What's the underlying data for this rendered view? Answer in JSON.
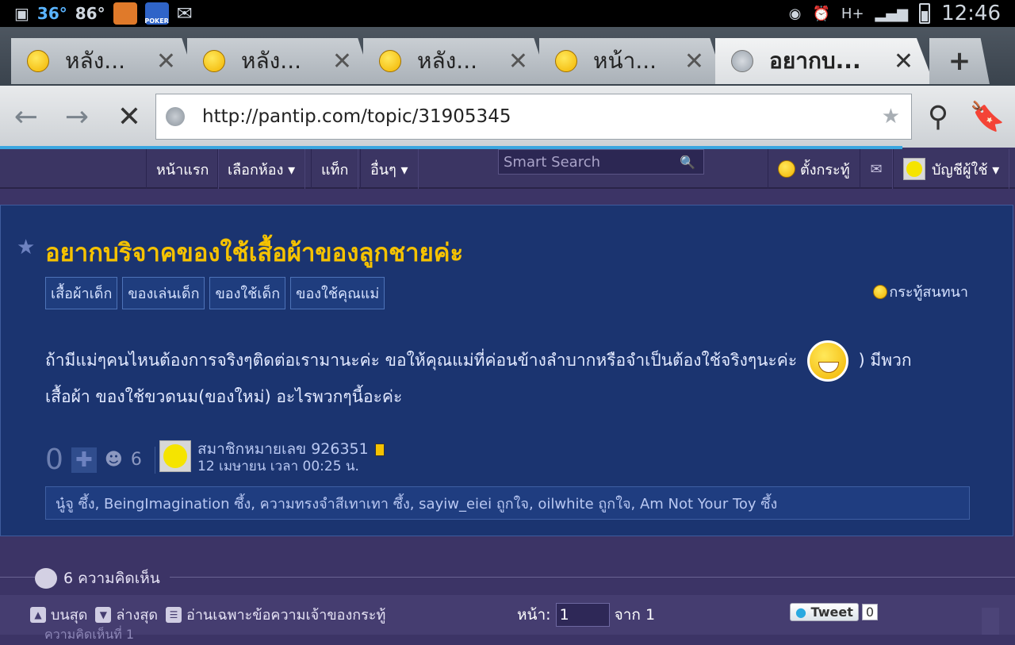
{
  "status_bar": {
    "temp_c": "36°",
    "temp_f": "86°",
    "time": "12:46",
    "network": "H+",
    "app_poker": "POKER"
  },
  "tabs": [
    {
      "label": "หลัง...",
      "active": false
    },
    {
      "label": "หลัง...",
      "active": false
    },
    {
      "label": "หลัง...",
      "active": false
    },
    {
      "label": "หน้า...",
      "active": false
    },
    {
      "label": "อยากบ...",
      "active": true
    }
  ],
  "toolbar": {
    "url": "http://pantip.com/topic/31905345"
  },
  "site_nav": {
    "home": "หน้าแรก",
    "choose_room": "เลือกห้อง ▾",
    "tags": "แท็ก",
    "other": "อื่นๆ ▾",
    "search_placeholder": "Smart Search",
    "new_topic": "ตั้งกระทู้",
    "account": "บัญชีผู้ใช้ ▾"
  },
  "topic": {
    "title": "อยากบริจาคของใช้เสื้อผ้าของลูกชายค่ะ",
    "tags": [
      "เสื้อผ้าเด็ก",
      "ของเล่นเด็ก",
      "ของใช้เด็ก",
      "ของใช้คุณแม่"
    ],
    "type": "กระทู้สนทนา",
    "body_line1a": "ถ้ามีแม่ๆคนไหนต้องการจริงๆติดต่อเรามานะค่ะ ขอให้คุณแม่ที่ค่อนข้างลำบากหรือจำเป็นต้องใช้จริงๆนะค่ะ",
    "body_line1b": ") มีพวก",
    "body_line2": "เสื้อผ้า ของใช้ขวดนม(ของใหม่) อะไรพวกๆนี้อะค่ะ",
    "votes": "0",
    "emotions": "6",
    "author": "สมาชิกหมายเลข 926351",
    "posted": "12 เมษายน เวลา 00:25 น.",
    "reactions": "นู๋จู ซึ้ง, BeingImagination ซึ้ง, ความทรงจำสีเทาเทา ซึ้ง, sayiw_eiei ถูกใจ, oilwhite ถูกใจ, Am Not Your Toy ซึ้ง"
  },
  "comments": {
    "count_label": "6 ความคิดเห็น",
    "first_peek": "ความคิดเห็นที่ 1"
  },
  "bottom_bar": {
    "top": "บนสุด",
    "bottom": "ล่างสุด",
    "owner_only": "อ่านเฉพาะข้อความเจ้าของกระทู้",
    "page_label": "หน้า:",
    "page_value": "1",
    "of_label": "จาก 1",
    "tweet": "Tweet",
    "tweet_count": "0"
  }
}
